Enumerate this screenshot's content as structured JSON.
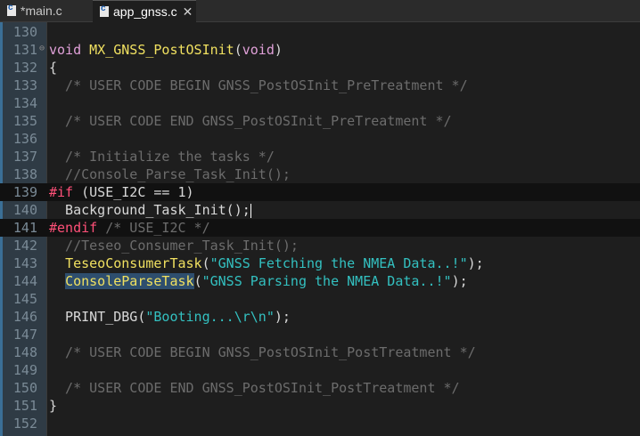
{
  "tabs": [
    {
      "label": "*main.c",
      "active": false
    },
    {
      "label": "app_gnss.c",
      "active": true
    }
  ],
  "tab_close_glyph": "✕",
  "lines": [
    {
      "num": "130",
      "parts": [
        {
          "t": ""
        }
      ]
    },
    {
      "num": "131",
      "fold": "⊖",
      "parts": [
        {
          "t": "void",
          "c": "kw"
        },
        {
          "t": " "
        },
        {
          "t": "MX_GNSS_PostOSInit",
          "c": "fn"
        },
        {
          "t": "("
        },
        {
          "t": "void",
          "c": "kw"
        },
        {
          "t": ")"
        }
      ]
    },
    {
      "num": "132",
      "parts": [
        {
          "t": "{"
        }
      ]
    },
    {
      "num": "133",
      "parts": [
        {
          "t": "  /* USER CODE BEGIN GNSS_PostOSInit_PreTreatment */",
          "c": "cm"
        }
      ]
    },
    {
      "num": "134",
      "parts": [
        {
          "t": ""
        }
      ]
    },
    {
      "num": "135",
      "parts": [
        {
          "t": "  /* USER CODE END GNSS_PostOSInit_PreTreatment */",
          "c": "cm"
        }
      ]
    },
    {
      "num": "136",
      "parts": [
        {
          "t": ""
        }
      ]
    },
    {
      "num": "137",
      "parts": [
        {
          "t": "  /* Initialize the tasks */",
          "c": "cm"
        }
      ]
    },
    {
      "num": "138",
      "parts": [
        {
          "t": "  //Console_Parse_Task_Init();",
          "c": "cm"
        }
      ]
    },
    {
      "num": "139",
      "hl": true,
      "parts": [
        {
          "t": "#if",
          "c": "pp"
        },
        {
          "t": " (USE_I2C == 1)"
        }
      ]
    },
    {
      "num": "140",
      "caret": true,
      "parts": [
        {
          "t": "  Background_Task_Init();"
        }
      ]
    },
    {
      "num": "141",
      "hl": true,
      "parts": [
        {
          "t": "#endif",
          "c": "pp"
        },
        {
          "t": " /* USE_I2C */",
          "c": "cm"
        }
      ]
    },
    {
      "num": "142",
      "parts": [
        {
          "t": "  //Teseo_Consumer_Task_Init();",
          "c": "cm"
        }
      ]
    },
    {
      "num": "143",
      "parts": [
        {
          "t": "  "
        },
        {
          "t": "TeseoConsumerTask",
          "c": "fn"
        },
        {
          "t": "("
        },
        {
          "t": "\"GNSS Fetching the NMEA Data..!\"",
          "c": "str"
        },
        {
          "t": ");"
        }
      ]
    },
    {
      "num": "144",
      "parts": [
        {
          "t": "  "
        },
        {
          "t": "ConsoleParseTask",
          "c": "fnsel"
        },
        {
          "t": "("
        },
        {
          "t": "\"GNSS Parsing the NMEA Data..!\"",
          "c": "str"
        },
        {
          "t": ");"
        }
      ]
    },
    {
      "num": "145",
      "parts": [
        {
          "t": ""
        }
      ]
    },
    {
      "num": "146",
      "parts": [
        {
          "t": "  PRINT_DBG("
        },
        {
          "t": "\"Booting...\\r\\n\"",
          "c": "str"
        },
        {
          "t": ");"
        }
      ]
    },
    {
      "num": "147",
      "parts": [
        {
          "t": ""
        }
      ]
    },
    {
      "num": "148",
      "parts": [
        {
          "t": "  /* USER CODE BEGIN GNSS_PostOSInit_PostTreatment */",
          "c": "cm"
        }
      ]
    },
    {
      "num": "149",
      "parts": [
        {
          "t": ""
        }
      ]
    },
    {
      "num": "150",
      "parts": [
        {
          "t": "  /* USER CODE END GNSS_PostOSInit_PostTreatment */",
          "c": "cm"
        }
      ]
    },
    {
      "num": "151",
      "parts": [
        {
          "t": "}"
        }
      ]
    },
    {
      "num": "152",
      "parts": [
        {
          "t": ""
        }
      ]
    }
  ]
}
